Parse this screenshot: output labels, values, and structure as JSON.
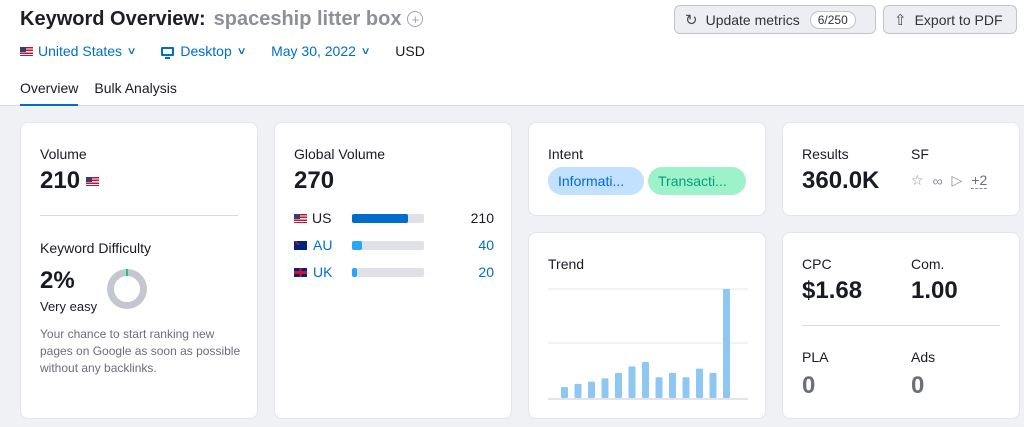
{
  "header": {
    "title": "Keyword Overview:",
    "keyword": "spaceship litter box",
    "update_label": "Update metrics",
    "update_badge": "6/250",
    "export_label": "Export to PDF"
  },
  "filters": {
    "country": "United States",
    "device": "Desktop",
    "date": "May 30, 2022",
    "currency": "USD"
  },
  "tabs": [
    {
      "label": "Overview",
      "active": true
    },
    {
      "label": "Bulk Analysis",
      "active": false
    }
  ],
  "volume": {
    "label": "Volume",
    "value": "210"
  },
  "keyword_difficulty": {
    "label": "Keyword Difficulty",
    "value": "2%",
    "rating": "Very easy",
    "percent": 2,
    "description": "Your chance to start ranking new pages on Google as soon as possible without any backlinks."
  },
  "global_volume": {
    "label": "Global Volume",
    "value": "270",
    "countries": [
      {
        "code": "US",
        "value": "210",
        "share": 0.78,
        "color": "#006dca"
      },
      {
        "code": "AU",
        "value": "40",
        "share": 0.14,
        "color": "#2ba5f7"
      },
      {
        "code": "UK",
        "value": "20",
        "share": 0.07,
        "color": "#2ba5f7"
      }
    ]
  },
  "intent": {
    "label": "Intent",
    "chips": [
      "Informati...",
      "Transacti..."
    ]
  },
  "trend": {
    "label": "Trend",
    "values": [
      10,
      13,
      15,
      18,
      23,
      29,
      33,
      19,
      23,
      19,
      27,
      23,
      100
    ],
    "bar_color": "#8ec7f2"
  },
  "results": {
    "label": "Results",
    "value": "360.0K"
  },
  "serp_features": {
    "label": "SF",
    "icons": [
      "star-icon",
      "link-icon",
      "video-icon"
    ],
    "more": "+2"
  },
  "cpc": {
    "label": "CPC",
    "value": "$1.68"
  },
  "competition": {
    "label": "Com.",
    "value": "1.00"
  },
  "pla": {
    "label": "PLA",
    "value": "0"
  },
  "ads": {
    "label": "Ads",
    "value": "0"
  }
}
